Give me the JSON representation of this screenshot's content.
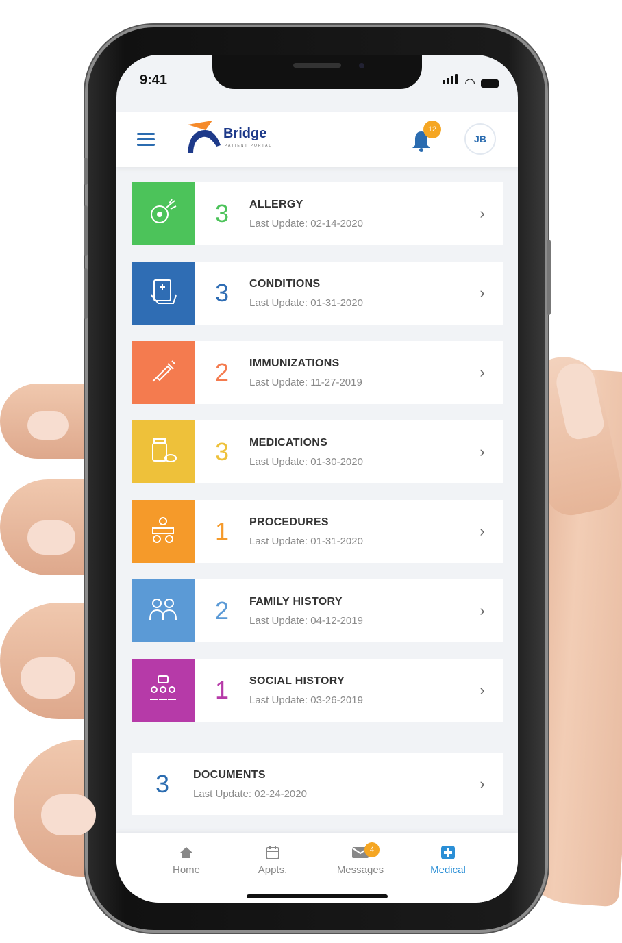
{
  "status_bar": {
    "time": "9:41"
  },
  "header": {
    "logo_name": "Bridge",
    "logo_sub": "PATIENT PORTAL",
    "notification_count": "12",
    "avatar_initials": "JB"
  },
  "records": [
    {
      "count": "3",
      "title": "ALLERGY",
      "updated": "Last Update: 02-14-2020",
      "color": "#4cc35a",
      "icon": "allergy-icon"
    },
    {
      "count": "3",
      "title": "CONDITIONS",
      "updated": "Last Update: 01-31-2020",
      "color": "#2f6db4",
      "icon": "conditions-icon"
    },
    {
      "count": "2",
      "title": "IMMUNIZATIONS",
      "updated": "Last Update: 11-27-2019",
      "color": "#f47b4f",
      "icon": "syringe-icon"
    },
    {
      "count": "3",
      "title": "MEDICATIONS",
      "updated": "Last Update: 01-30-2020",
      "color": "#eec13a",
      "icon": "pill-bottle-icon"
    },
    {
      "count": "1",
      "title": "PROCEDURES",
      "updated": "Last Update: 01-31-2020",
      "color": "#f59a2a",
      "icon": "procedures-icon"
    },
    {
      "count": "2",
      "title": "FAMILY HISTORY",
      "updated": "Last Update: 04-12-2019",
      "color": "#5b9ad6",
      "icon": "family-icon"
    },
    {
      "count": "1",
      "title": "SOCIAL HISTORY",
      "updated": "Last Update: 03-26-2019",
      "color": "#b63aa8",
      "icon": "social-icon"
    }
  ],
  "documents": {
    "count": "3",
    "title": "DOCUMENTS",
    "updated": "Last Update: 02-24-2020"
  },
  "tabbar": {
    "home": "Home",
    "appts": "Appts.",
    "messages": "Messages",
    "messages_badge": "4",
    "medical": "Medical",
    "active": "Medical"
  }
}
